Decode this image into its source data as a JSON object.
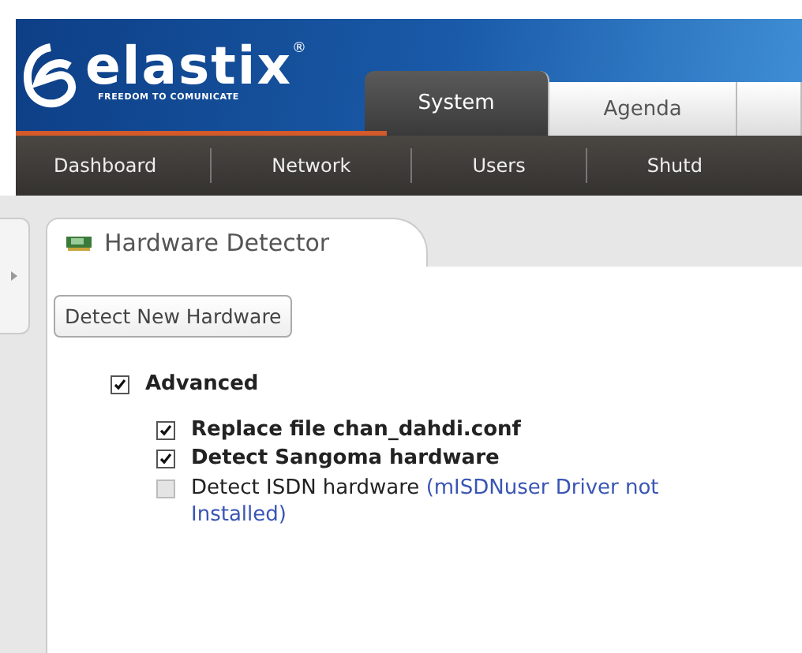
{
  "logo": {
    "name": "elastix",
    "mark": "®",
    "tagline": "FREEDOM TO COMUNICATE"
  },
  "tabs": [
    {
      "label": "System",
      "selected": true
    },
    {
      "label": "Agenda",
      "selected": false
    },
    {
      "selected": false
    }
  ],
  "menu": [
    "Dashboard",
    "Network",
    "Users",
    "Shutd"
  ],
  "panel": {
    "title": "Hardware Detector",
    "button": "Detect New Hardware",
    "advanced": {
      "label": "Advanced",
      "checked": true
    },
    "options": [
      {
        "label": "Replace file chan_dahdi.conf",
        "checked": true,
        "disabled": false
      },
      {
        "label": "Detect Sangoma hardware",
        "checked": true,
        "disabled": false
      },
      {
        "label": "Detect ISDN hardware",
        "checked": false,
        "disabled": true,
        "note": "(mISDNuser Driver not Installed)"
      }
    ]
  }
}
